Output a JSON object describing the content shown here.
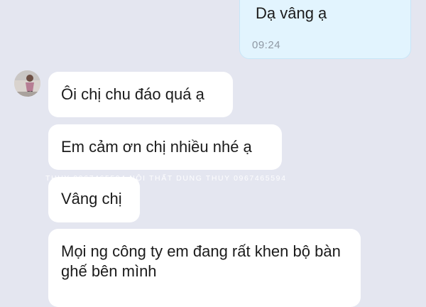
{
  "conversation": {
    "outgoing": [
      {
        "text": "Dạ vâng ạ",
        "time": "09:24"
      }
    ],
    "incoming": [
      {
        "text": "Ôi chị chu đáo quá ạ"
      },
      {
        "text": "Em cảm ơn chị nhiều nhé ạ"
      },
      {
        "text": "Vâng chị"
      },
      {
        "text": "Mọi ng công ty em đang rất khen bộ bàn ghế bên mình"
      }
    ],
    "avatar_icon": "contact-avatar"
  },
  "watermark": {
    "text": "THUY 0967465594 NỘI THẤT DUNG THUY 0967465594"
  },
  "colors": {
    "background": "#e4e6f0",
    "incoming_bubble": "#ffffff",
    "outgoing_bubble": "#e2f4fe",
    "time_text": "#8f98a3"
  }
}
